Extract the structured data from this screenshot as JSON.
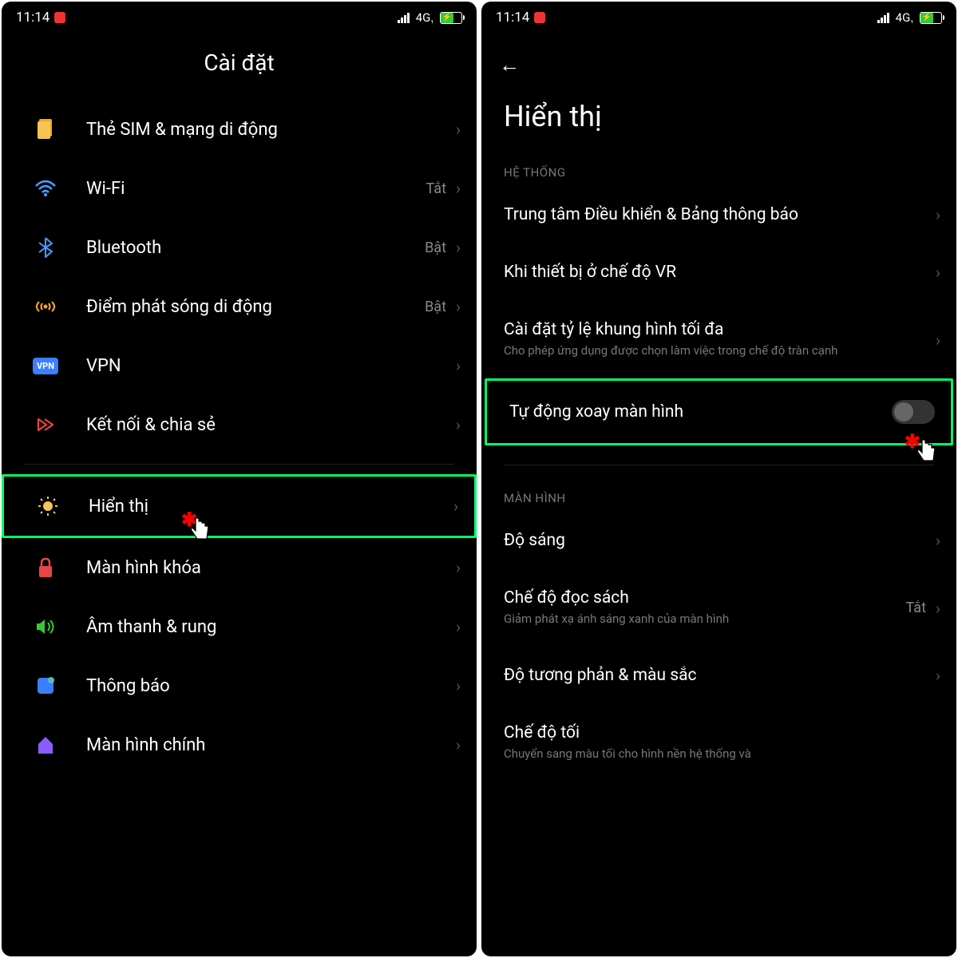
{
  "status": {
    "time": "11:14",
    "network": "4G",
    "signal_sub": "₁"
  },
  "screen1": {
    "title": "Cài đặt",
    "items": [
      {
        "label": "Thẻ SIM & mạng di động",
        "value": ""
      },
      {
        "label": "Wi-Fi",
        "value": "Tắt"
      },
      {
        "label": "Bluetooth",
        "value": "Bật"
      },
      {
        "label": "Điểm phát sóng di động",
        "value": "Bật"
      },
      {
        "label": "VPN",
        "value": ""
      },
      {
        "label": "Kết nối & chia sẻ",
        "value": ""
      },
      {
        "label": "Hiển thị",
        "value": ""
      },
      {
        "label": "Màn hình khóa",
        "value": ""
      },
      {
        "label": "Âm thanh & rung",
        "value": ""
      },
      {
        "label": "Thông báo",
        "value": ""
      },
      {
        "label": "Màn hình chính",
        "value": ""
      }
    ]
  },
  "screen2": {
    "title": "Hiển thị",
    "section1": "HỆ THỐNG",
    "section2": "MÀN HÌNH",
    "items1": [
      {
        "label": "Trung tâm Điều khiển & Bảng thông báo",
        "sub": ""
      },
      {
        "label": "Khi thiết bị ở chế độ VR",
        "sub": ""
      },
      {
        "label": "Cài đặt tỷ lệ khung hình tối đa",
        "sub": "Cho phép ứng dụng được chọn làm việc trong chế độ tràn cạnh"
      },
      {
        "label": "Tự động xoay màn hình",
        "sub": ""
      }
    ],
    "items2": [
      {
        "label": "Độ sáng",
        "sub": "",
        "value": ""
      },
      {
        "label": "Chế độ đọc sách",
        "sub": "Giảm phát xạ ánh sáng xanh của màn hình",
        "value": "Tắt"
      },
      {
        "label": "Độ tương phản & màu sắc",
        "sub": "",
        "value": ""
      },
      {
        "label": "Chế độ tối",
        "sub": "Chuyển sang màu tối cho hình nền hệ thống và",
        "value": ""
      }
    ]
  }
}
